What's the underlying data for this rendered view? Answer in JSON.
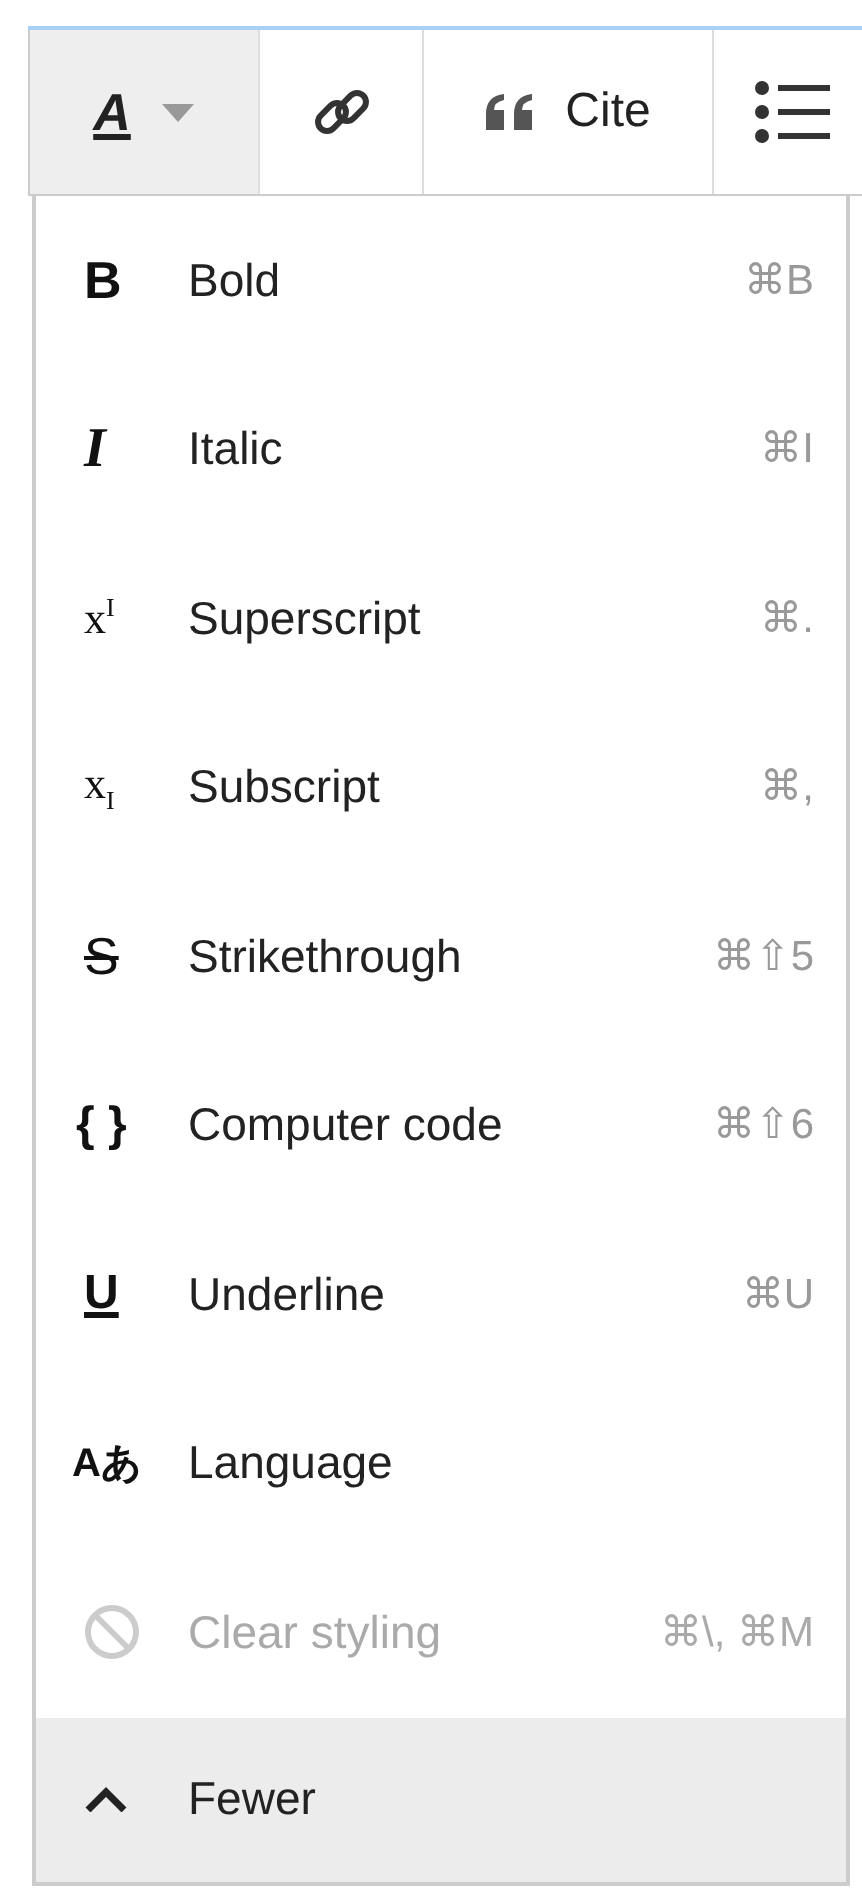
{
  "toolbar": [
    {
      "kind": "text-style",
      "glyph": "A",
      "selected": true
    },
    {
      "kind": "link",
      "selected": false
    },
    {
      "kind": "cite",
      "label": "Cite",
      "selected": false
    },
    {
      "kind": "list",
      "selected": false
    }
  ],
  "menu": {
    "items": [
      {
        "kind": "bold",
        "icon": "B",
        "label": "Bold",
        "shortcut": "⌘B",
        "disabled": false
      },
      {
        "kind": "italic",
        "icon": "I",
        "label": "Italic",
        "shortcut": "⌘I",
        "disabled": false
      },
      {
        "kind": "superscript",
        "icon": "x$^{I}$",
        "label": "Superscript",
        "shortcut": "⌘.",
        "disabled": false
      },
      {
        "kind": "subscript",
        "icon": "x$_{I}$",
        "label": "Subscript",
        "shortcut": "⌘,",
        "disabled": false
      },
      {
        "kind": "strikethrough",
        "icon": "S",
        "label": "Strikethrough",
        "shortcut": "⌘⇧5",
        "disabled": false
      },
      {
        "kind": "code",
        "icon": "{ }",
        "label": "Computer code",
        "shortcut": "⌘⇧6",
        "disabled": false
      },
      {
        "kind": "underline",
        "icon": "U",
        "label": "Underline",
        "shortcut": "⌘U",
        "disabled": false
      },
      {
        "kind": "language",
        "icon": "Aあ",
        "label": "Language",
        "disabled": false
      },
      {
        "kind": "clear",
        "label": "Clear styling",
        "shortcut": "⌘\\, ⌘M",
        "disabled": true
      }
    ],
    "toggle": {
      "label": "Fewer",
      "expanded": true
    }
  }
}
